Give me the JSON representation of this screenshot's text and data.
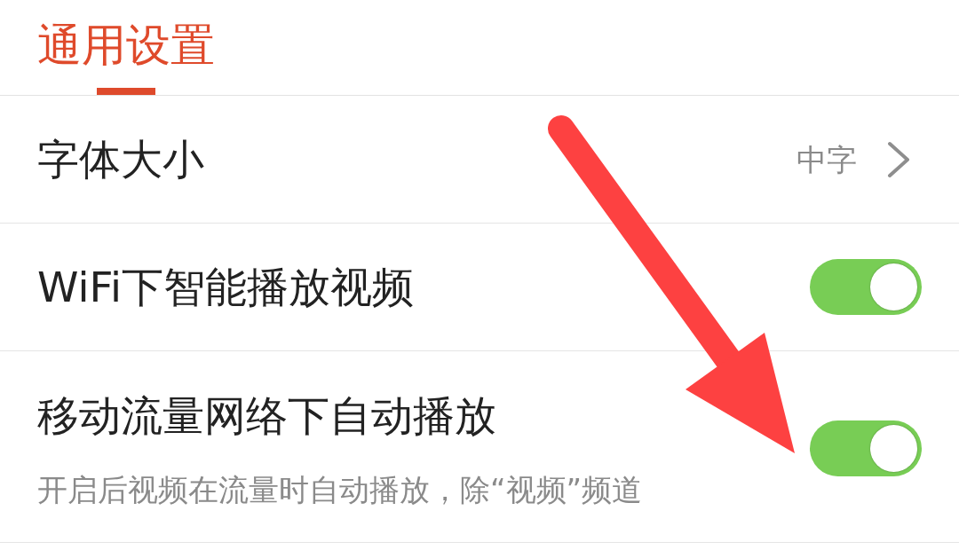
{
  "header": {
    "tabs": [
      {
        "label": "通用设置",
        "selected": true
      }
    ]
  },
  "settings": [
    {
      "kind": "value",
      "label": "字体大小",
      "value": "中字"
    },
    {
      "kind": "toggle",
      "label": "WiFi下智能播放视频",
      "on": true
    },
    {
      "kind": "toggle",
      "label": "移动流量网络下自动播放",
      "on": true,
      "description": "开启后视频在流量时自动播放，除“视频”频道"
    }
  ]
}
